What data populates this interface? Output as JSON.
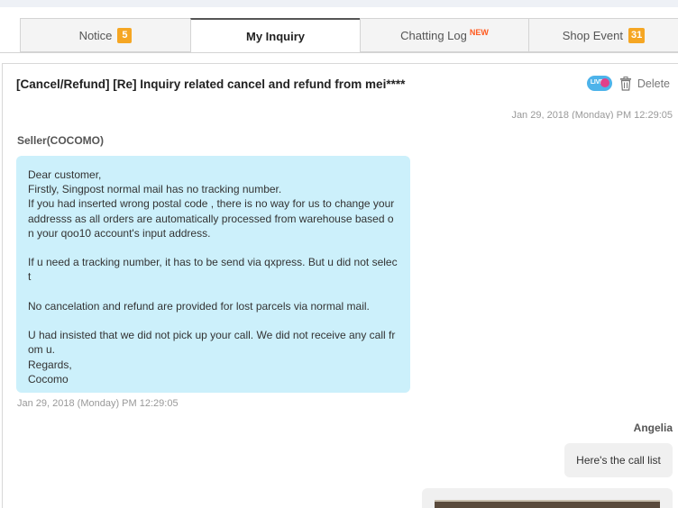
{
  "tabs": [
    {
      "label": "Notice",
      "badge": "5"
    },
    {
      "label": "My Inquiry"
    },
    {
      "label": "Chatting Log",
      "tag": "NEW"
    },
    {
      "label": "Shop Event",
      "badge": "31"
    }
  ],
  "inquiry": {
    "subject": "[Cancel/Refund] [Re] Inquiry related cancel and refund from mei****",
    "live_icon_text": "LIVE",
    "delete_label": "Delete",
    "cut_off_date": "Jan 29, 2018 (Monday) PM 12:29:05"
  },
  "messages": [
    {
      "sender": "Seller(COCOMO)",
      "body": "Dear customer,\nFirstly, Singpost normal mail has no tracking number.\nIf you had inserted wrong postal code , there is no way for us to change your\naddresss as all orders are automatically processed from warehouse based o\nn your qoo10 account's input address.\n\nIf u need a tracking number, it has to be send via qxpress. But u did not selec\nt\n\nNo cancelation and refund are provided for lost parcels via normal mail.\n\nU had insisted that we did not pick up your call. We did not receive any call fr\nom u.\nRegards,\nCocomo",
      "time": "Jan 29, 2018 (Monday) PM 12:29:05"
    },
    {
      "sender": "Angelia",
      "body": "Here's the call list"
    }
  ],
  "colors": {
    "seller_bubble": "#ccf0fb",
    "user_bubble": "#f0f0f0",
    "badge": "#f5a623",
    "new_tag": "#ff5a1f"
  }
}
